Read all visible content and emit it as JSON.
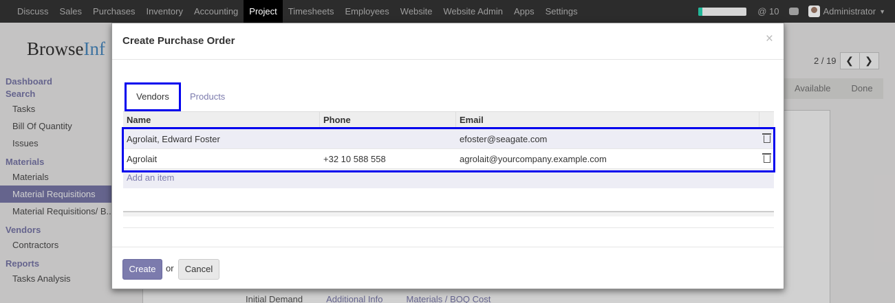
{
  "navbar": {
    "menu": [
      "Discuss",
      "Sales",
      "Purchases",
      "Inventory",
      "Accounting",
      "Project",
      "Timesheets",
      "Employees",
      "Website",
      "Website Admin",
      "Apps",
      "Settings"
    ],
    "active": "Project",
    "progress_fraction": 0.08,
    "messages_count": "@ 10",
    "user": "Administrator"
  },
  "background": {
    "logo_text": "Browse",
    "logo_accent": "Inf",
    "sidebar": [
      {
        "type": "head",
        "label": "Dashboard"
      },
      {
        "type": "head",
        "label": "Search"
      },
      {
        "type": "item",
        "label": "Tasks"
      },
      {
        "type": "item",
        "label": "Bill Of Quantity"
      },
      {
        "type": "item",
        "label": "Issues"
      },
      {
        "type": "head",
        "label": "Materials"
      },
      {
        "type": "item",
        "label": "Materials"
      },
      {
        "type": "item",
        "label": "Material Requisitions",
        "active": true
      },
      {
        "type": "item",
        "label": "Material Requisitions/ B..."
      },
      {
        "type": "head",
        "label": "Vendors"
      },
      {
        "type": "item",
        "label": "Contractors"
      },
      {
        "type": "head",
        "label": "Reports"
      },
      {
        "type": "item",
        "label": "Tasks Analysis"
      }
    ],
    "pager": "2 / 19",
    "stages": [
      "Available",
      "Done"
    ],
    "tabs": [
      "Initial Demand",
      "Additional Info",
      "Materials / BOQ Cost"
    ]
  },
  "dialog": {
    "title": "Create Purchase Order",
    "close": "×",
    "tabs": [
      "Vendors",
      "Products"
    ],
    "columns": [
      "Name",
      "Phone",
      "Email"
    ],
    "rows": [
      {
        "name": "Agrolait, Edward Foster",
        "phone": "",
        "email": "efoster@seagate.com"
      },
      {
        "name": "Agrolait",
        "phone": "+32 10 588 558",
        "email": "agrolait@yourcompany.example.com"
      }
    ],
    "add_item": "Add an item",
    "create_label": "Create",
    "or_label": "or",
    "cancel_label": "Cancel"
  },
  "colors": {
    "accent": "#7c7bad",
    "highlight_border": "#0000ee",
    "navbar": "#2c2c2c"
  }
}
